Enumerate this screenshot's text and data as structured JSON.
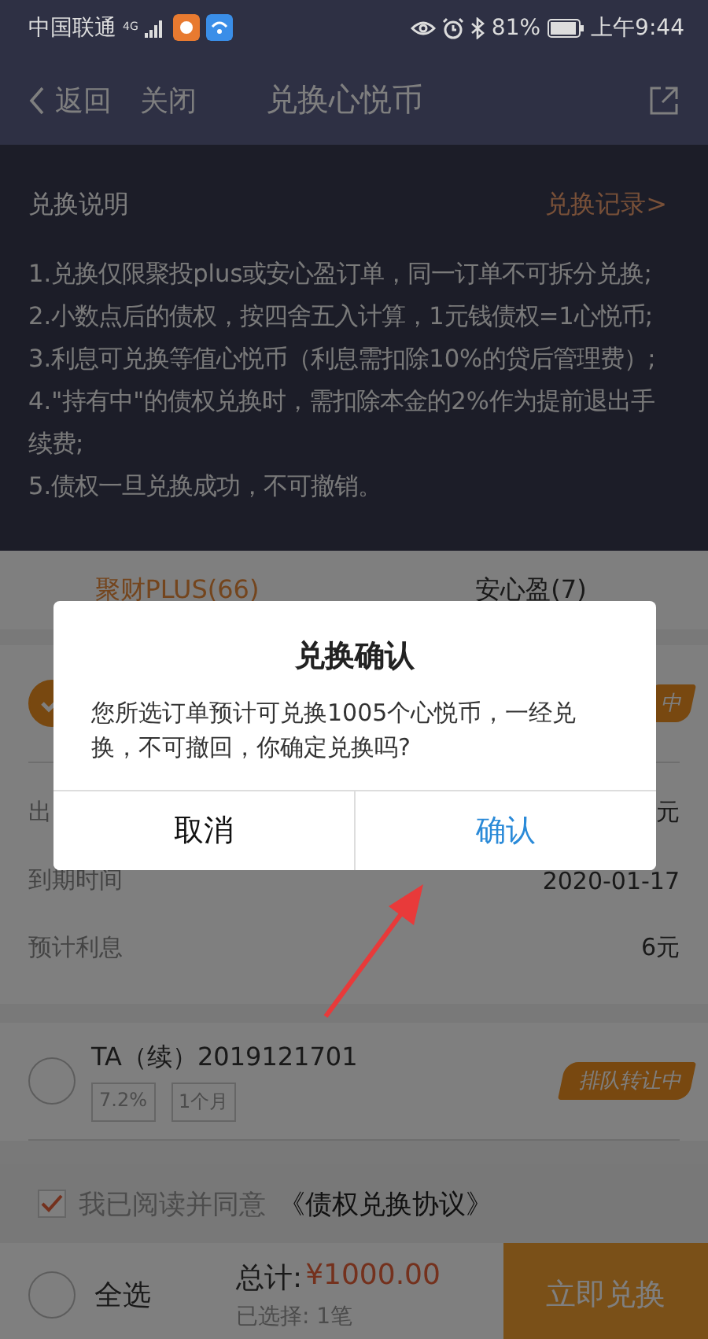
{
  "status_bar": {
    "carrier": "中国联通",
    "network": "4G",
    "battery": "81%",
    "time": "上午9:44"
  },
  "nav": {
    "back": "返回",
    "close": "关闭",
    "title": "兑换心悦币"
  },
  "rules": {
    "title": "兑换说明",
    "link": "兑换记录>",
    "items": [
      "1.兑换仅限聚投plus或安心盈订单，同一订单不可拆分兑换;",
      "2.小数点后的债权，按四舍五入计算，1元钱债权=1心悦币;",
      "3.利息可兑换等值心悦币（利息需扣除10%的贷后管理费）;",
      "4.\"持有中\"的债权兑换时，需扣除本金的2%作为提前退出手续费;",
      "5.债权一旦兑换成功，不可撤销。"
    ]
  },
  "tabs": [
    {
      "label": "聚财PLUS(66)",
      "selected": true
    },
    {
      "label": "安心盈(7)",
      "selected": false
    }
  ],
  "orders": [
    {
      "checked": true,
      "badge": "中",
      "rows": [
        {
          "label": "出",
          "value": "元"
        },
        {
          "label": "到期时间",
          "value": "2020-01-17"
        },
        {
          "label": "预计利息",
          "value": "6元"
        }
      ]
    },
    {
      "checked": false,
      "title": "TA（续）2019121701",
      "tags": [
        "7.2%",
        "1个月"
      ],
      "badge": "排队转让中"
    }
  ],
  "agreement": {
    "checked": true,
    "text": "我已阅读并同意",
    "link": "《债权兑换协议》"
  },
  "footer": {
    "select_all": "全选",
    "select_all_checked": false,
    "total_label": "总计:",
    "total": "¥1000.00",
    "selected_count": "已选择: 1笔",
    "submit": "立即兑换"
  },
  "dialog": {
    "title": "兑换确认",
    "message": "您所选订单预计可兑换1005个心悦币，一经兑换，不可撤回，你确定兑换吗?",
    "buttons": [
      {
        "label": "取消",
        "kind": "cancel"
      },
      {
        "label": "确认",
        "kind": "confirm"
      }
    ]
  }
}
